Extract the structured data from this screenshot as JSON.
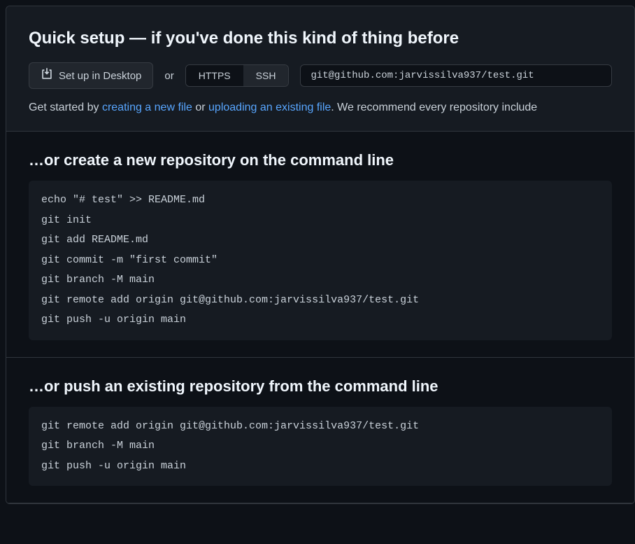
{
  "quickSetup": {
    "title": "Quick setup — if you've done this kind of thing before",
    "desktopBtn": "Set up in Desktop",
    "or": "or",
    "protocolHttps": "HTTPS",
    "protocolSsh": "SSH",
    "repoUrl": "git@github.com:jarvissilva937/test.git",
    "getStartedPrefix": "Get started by ",
    "linkCreateFile": "creating a new file",
    "getStartedMid": " or ",
    "linkUploadFile": "uploading an existing file",
    "getStartedSuffix": ". We recommend every repository include"
  },
  "createRepo": {
    "title": "…or create a new repository on the command line",
    "code": "echo \"# test\" >> README.md\ngit init\ngit add README.md\ngit commit -m \"first commit\"\ngit branch -M main\ngit remote add origin git@github.com:jarvissilva937/test.git\ngit push -u origin main"
  },
  "pushExisting": {
    "title": "…or push an existing repository from the command line",
    "code": "git remote add origin git@github.com:jarvissilva937/test.git\ngit branch -M main\ngit push -u origin main"
  }
}
